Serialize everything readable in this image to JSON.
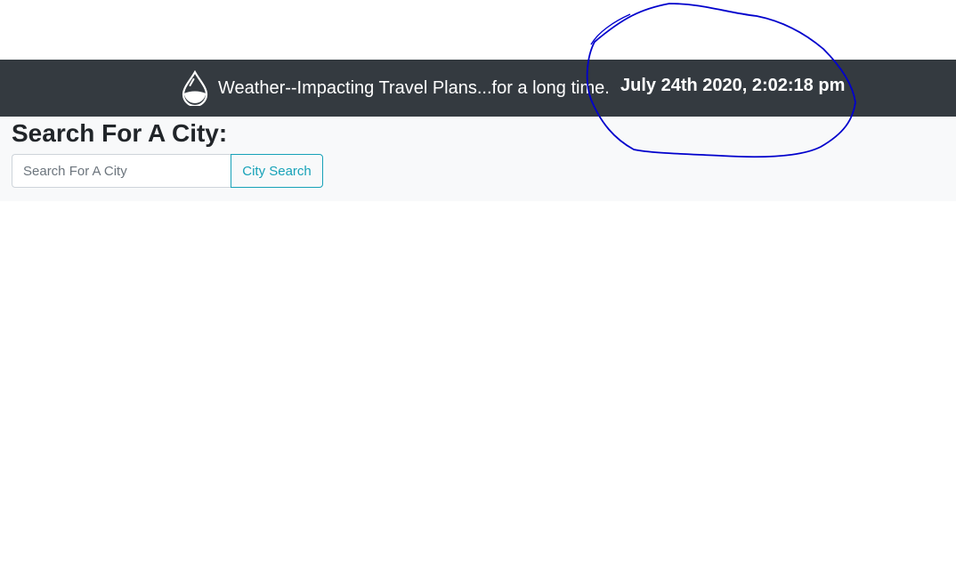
{
  "header": {
    "brand_text": "Weather--Impacting Travel Plans...for a long time.",
    "brand_icon": "water-drop-icon",
    "clock_text": "July 24th 2020, 2:02:18 pm"
  },
  "search": {
    "title": "Search For A City:",
    "placeholder": "Search For A City",
    "value": "",
    "button_label": "City Search"
  },
  "colors": {
    "navbar_bg": "#343a40",
    "panel_bg": "#f8f9fa",
    "button_accent": "#17a2b8",
    "annotation_ink": "#0000cc"
  }
}
